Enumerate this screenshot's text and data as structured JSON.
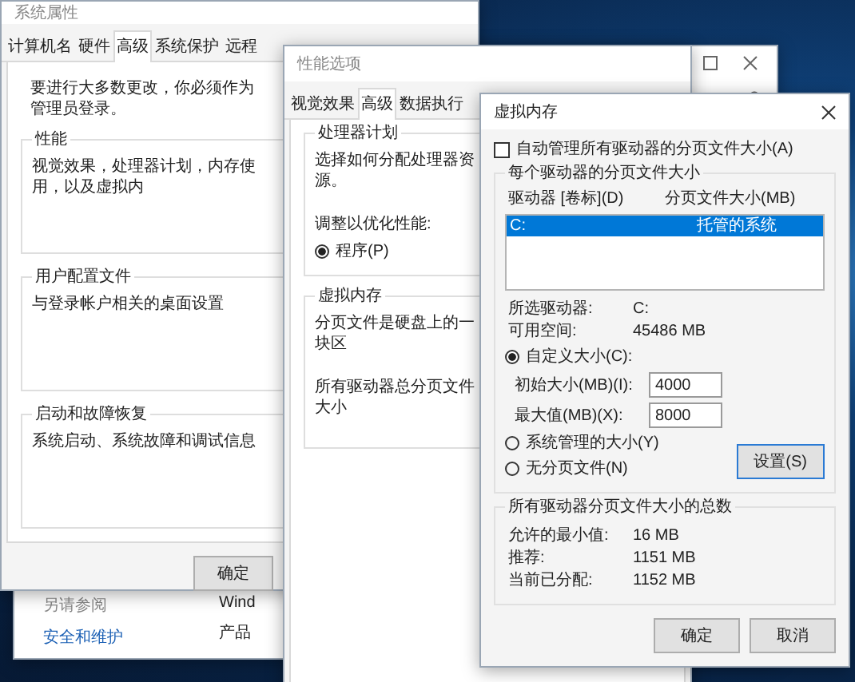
{
  "system_window": {
    "see_also": "另请参阅",
    "link": "安全和维护",
    "column_2": [
      "Wind",
      "产品"
    ]
  },
  "system_properties": {
    "title": "系统属性",
    "tabs": [
      {
        "label": "计算机名",
        "selected": false
      },
      {
        "label": "硬件",
        "selected": false
      },
      {
        "label": "高级",
        "selected": true
      },
      {
        "label": "系统保护",
        "selected": false
      },
      {
        "label": "远程",
        "selected": false
      }
    ],
    "notice": "要进行大多数更改，你必须作为管理员登录。",
    "groups": [
      {
        "title": "性能",
        "text": "视觉效果，处理器计划，内存使用，以及虚拟内"
      },
      {
        "title": "用户配置文件",
        "text": "与登录帐户相关的桌面设置"
      },
      {
        "title": "启动和故障恢复",
        "text": "系统启动、系统故障和调试信息"
      }
    ],
    "buttons": [
      "确定"
    ]
  },
  "performance_options": {
    "title": "性能选项",
    "tabs": [
      {
        "label": "视觉效果",
        "selected": false
      },
      {
        "label": "高级",
        "selected": true
      },
      {
        "label": "数据执行",
        "selected": false
      }
    ],
    "processor_group": {
      "title": "处理器计划",
      "text": "选择如何分配处理器资源。",
      "prompt": "调整以优化性能:",
      "option": {
        "label": "程序(P)",
        "selected": true
      }
    },
    "memory_group": {
      "title": "虚拟内存",
      "lines": [
        "分页文件是硬盘上的一块区",
        "所有驱动器总分页文件大小"
      ]
    }
  },
  "virtual_memory": {
    "title": "虚拟内存",
    "auto_manage": {
      "label": "自动管理所有驱动器的分页文件大小(A)",
      "checked": false
    },
    "group_title": "每个驱动器的分页文件大小",
    "columns": [
      "驱动器 [卷标](D)",
      "分页文件大小(MB)"
    ],
    "drives": [
      {
        "drive": "C:",
        "size": "托管的系统",
        "selected": true
      }
    ],
    "drive_info": [
      {
        "label": "所选驱动器:",
        "value": "C:"
      },
      {
        "label": "可用空间:",
        "value": "45486 MB"
      }
    ],
    "options": [
      {
        "kind": "radio",
        "label": "自定义大小(C):",
        "selected": true
      },
      {
        "kind": "field",
        "label": "初始大小(MB)(I):",
        "value": "4000"
      },
      {
        "kind": "field",
        "label": "最大值(MB)(X):",
        "value": "8000"
      },
      {
        "kind": "radio",
        "label": "系统管理的大小(Y)",
        "selected": false
      },
      {
        "kind": "radio",
        "label": "无分页文件(N)",
        "selected": false
      }
    ],
    "set_button": "设置(S)",
    "totals": {
      "title": "所有驱动器分页文件大小的总数",
      "rows": [
        {
          "label": "允许的最小值:",
          "value": "16 MB"
        },
        {
          "label": "推荐:",
          "value": "1151 MB"
        },
        {
          "label": "当前已分配:",
          "value": "1152 MB"
        }
      ]
    },
    "buttons": [
      "确定",
      "取消"
    ]
  }
}
